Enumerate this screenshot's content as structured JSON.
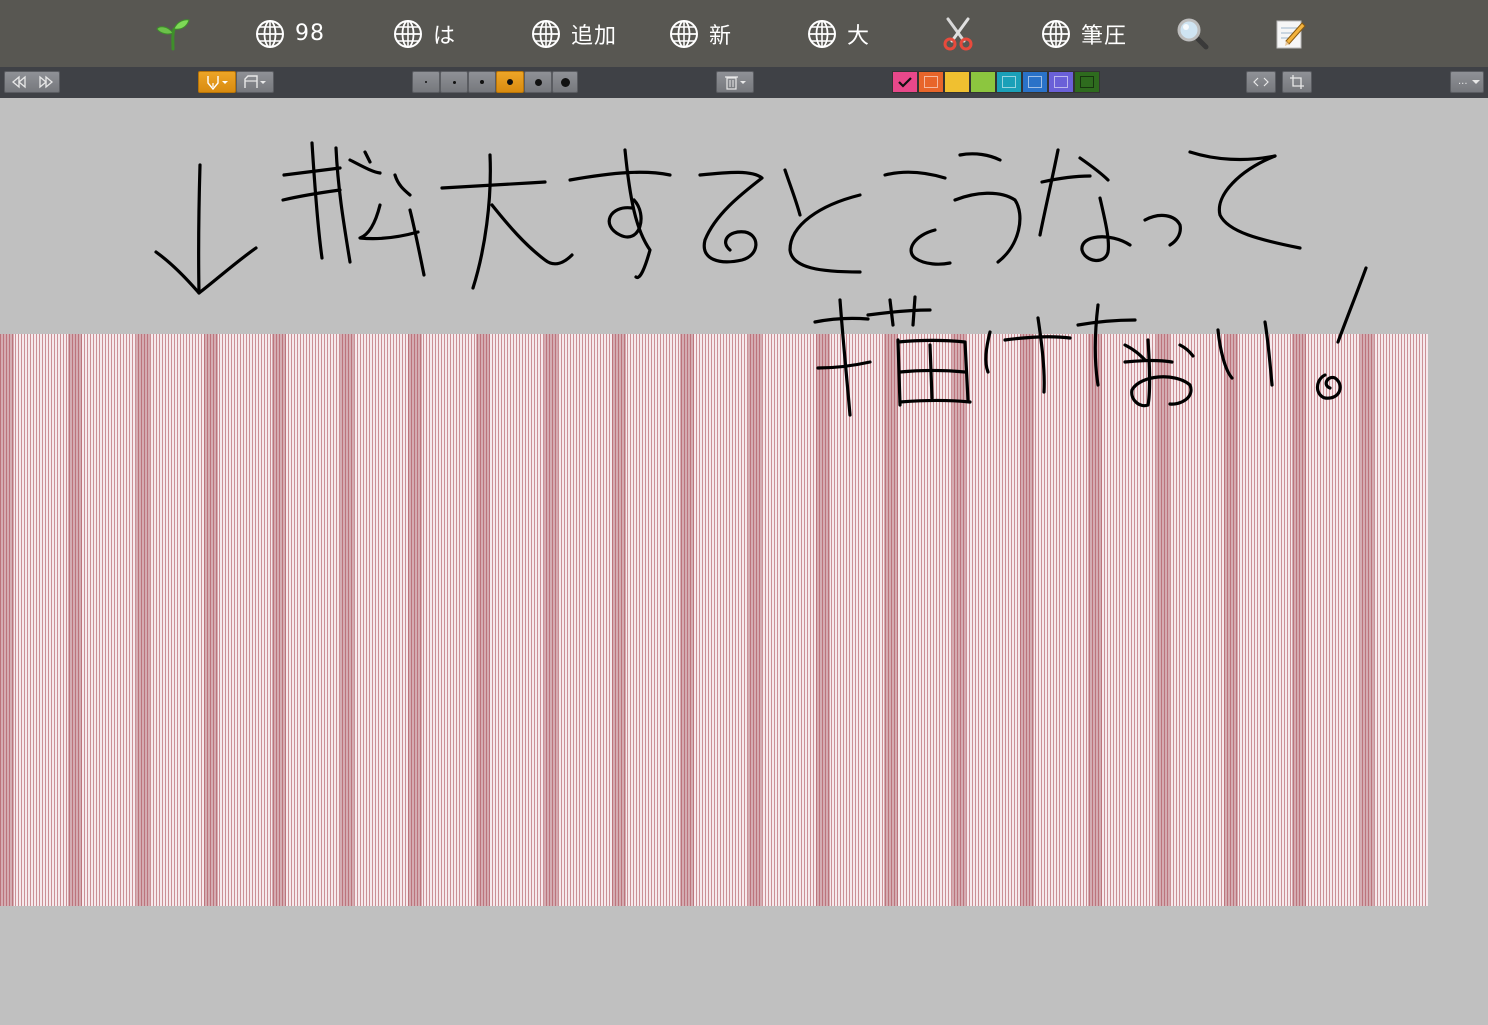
{
  "toolbar": {
    "items": [
      {
        "name": "sprout-icon",
        "icon": "sprout-icon",
        "label": ""
      },
      {
        "name": "globe-98",
        "icon": "globe-icon",
        "label": "98"
      },
      {
        "name": "globe-ha",
        "icon": "globe-icon",
        "label": "は"
      },
      {
        "name": "globe-tsuika",
        "icon": "globe-icon",
        "label": "追加"
      },
      {
        "name": "globe-shin",
        "icon": "globe-icon",
        "label": "新"
      },
      {
        "name": "globe-dai",
        "icon": "globe-icon",
        "label": "大"
      },
      {
        "name": "scissors-icon",
        "icon": "scissors-icon",
        "label": ""
      },
      {
        "name": "globe-hitsuatsu",
        "icon": "globe-icon",
        "label": "筆圧"
      },
      {
        "name": "magnifier-icon",
        "icon": "magnifier-icon",
        "label": ""
      },
      {
        "name": "memo-icon",
        "icon": "memo-icon",
        "label": ""
      }
    ]
  },
  "subbar": {
    "more_label": "...",
    "swatches": [
      "#e8488a",
      "#e8652a",
      "#f0c030",
      "#8cc63f",
      "#1aa0b8",
      "#2a72c8",
      "#6a60d8",
      "#2e6b1e"
    ],
    "selected_swatch": 0
  },
  "colors": {
    "topbar": "#585752",
    "subbar": "#3f4146",
    "active": "#e8a020",
    "background": "#c0c0c0",
    "ink": "#000000"
  }
}
